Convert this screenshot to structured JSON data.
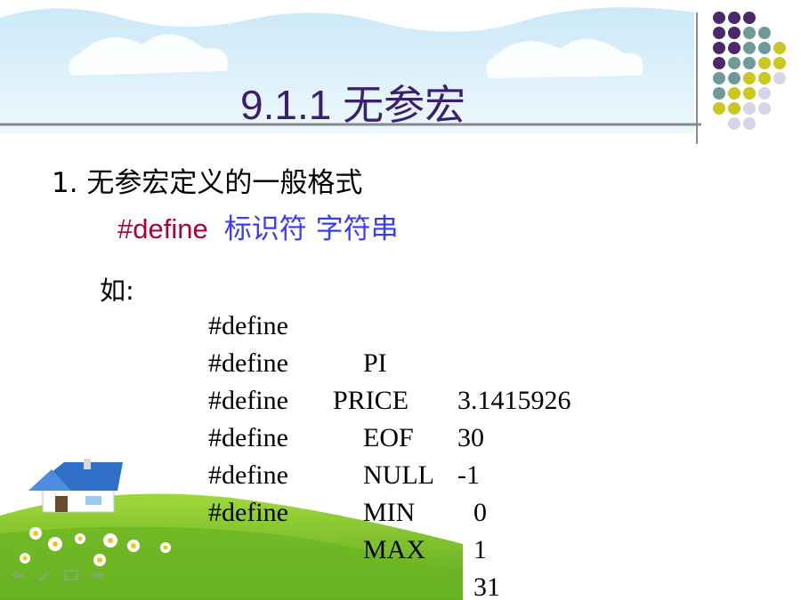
{
  "slide": {
    "title": "9.1.1 无参宏",
    "heading": "1. 无参宏定义的一般格式",
    "syntax": {
      "keyword": "#define",
      "rest": "标识符  字符串"
    },
    "example_label": "如:",
    "defines": [
      {
        "directive": "#define",
        "name": "PI",
        "value": "3.1415926"
      },
      {
        "directive": "#define",
        "name": "PRICE",
        "value": "30"
      },
      {
        "directive": "#define",
        "name": "EOF",
        "value": "-1"
      },
      {
        "directive": "#define",
        "name": "NULL",
        "value": "0"
      },
      {
        "directive": "#define",
        "name": "MIN",
        "value": "1"
      },
      {
        "directive": "#define",
        "name": "MAX",
        "value": "31"
      }
    ]
  },
  "colors": {
    "title": "#3a1f6e",
    "keyword": "#b0003a",
    "syntax_rest": "#3a3aff",
    "dot_purple": "#4b2a6b",
    "dot_teal": "#6f9a9a",
    "dot_yellow": "#c8c81e",
    "dot_lavender": "#d8d4e8",
    "sky": "#cfe9f7",
    "grass": "#7cc22a"
  },
  "icons": [
    "house-icon",
    "flower-icon",
    "nav-prev-icon",
    "nav-pen-icon",
    "nav-menu-icon",
    "nav-next-icon"
  ]
}
